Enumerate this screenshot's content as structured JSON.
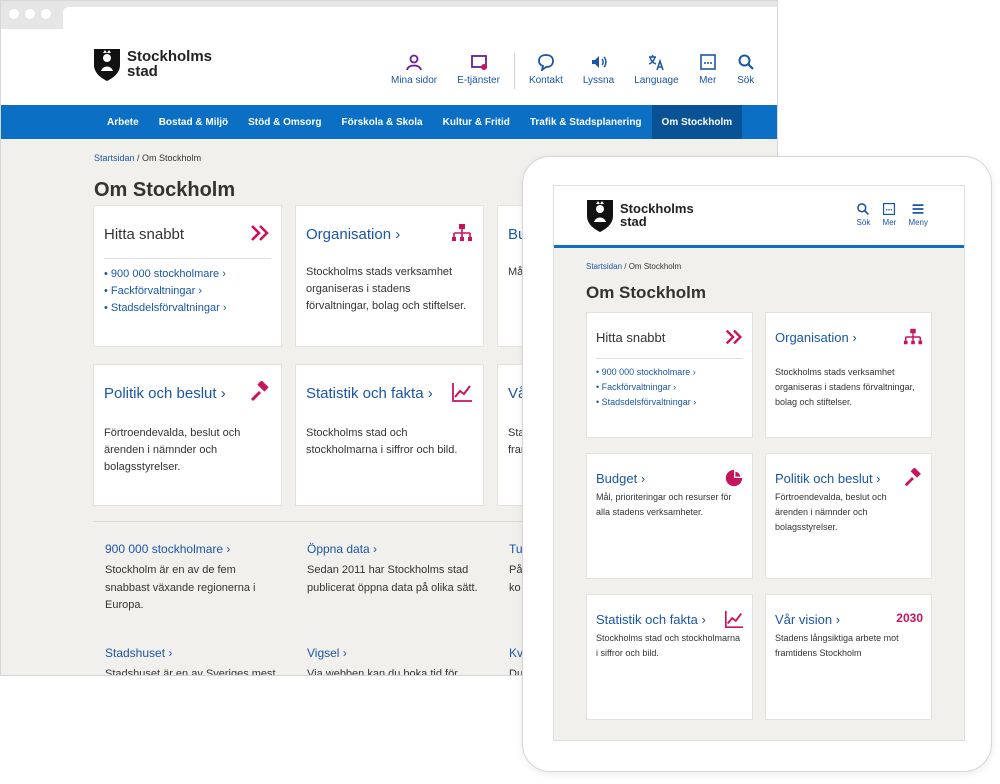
{
  "brand": {
    "line1": "Stockholms",
    "line2": "stad",
    "accent": "#c7145d",
    "primary": "#0b6fc4"
  },
  "desktop": {
    "header_icons": [
      {
        "icon": "person-icon",
        "label": "Mina sidor"
      },
      {
        "icon": "e-services-icon",
        "label": "E-tjänster"
      },
      {
        "icon": "chat-icon",
        "label": "Kontakt"
      },
      {
        "icon": "speaker-icon",
        "label": "Lyssna"
      },
      {
        "icon": "translate-icon",
        "label": "Language"
      },
      {
        "icon": "more-icon",
        "label": "Mer"
      },
      {
        "icon": "search-icon",
        "label": "Sök"
      }
    ],
    "nav": [
      "Arbete",
      "Bostad & Miljö",
      "Stöd & Omsorg",
      "Förskola & Skola",
      "Kultur & Fritid",
      "Trafik & Stadsplanering",
      "Om Stockholm"
    ],
    "breadcrumb": {
      "home": "Startsidan",
      "sep": " / ",
      "current": "Om Stockholm"
    },
    "title": "Om Stockholm",
    "cards": {
      "hitta": {
        "title": "Hitta snabbt",
        "links": [
          "900 000 stockholmare ›",
          "Fackförvaltningar ›",
          "Stadsdelsförvaltningar ›"
        ]
      },
      "org": {
        "title": "Organisation ›",
        "text": "Stockholms stads verksamhet organiseras i stadens förvaltningar, bolag och stiftelser."
      },
      "bu": {
        "title": "Bu",
        "text": "Mål"
      },
      "politik": {
        "title": "Politik och beslut ›",
        "text": "Förtroendevalda, beslut och ärenden i nämnder och bolagsstyrelser."
      },
      "statistik": {
        "title": "Statistik och fakta ›",
        "text": "Stockholms stad och stockholmarna i siffror och bild."
      },
      "var": {
        "title": "Vår",
        "text1": "Sta",
        "text2": "fram"
      }
    },
    "lower": {
      "a_title": "900 000 stockholmare ›",
      "a_text": "Stockholm är en av de fem snabbast växande regionerna i Europa.",
      "b_title": "Öppna data ›",
      "b_text": "Sedan 2011 har Stockholms stad publicerat öppna data på olika sätt.",
      "c_title": "Tu",
      "c_text1": "På",
      "c_text2": "ko",
      "d_title": "Stadshuset ›",
      "d_text": "Stadshuset är en av Sveriges mest",
      "e_title": "Vigsel ›",
      "e_text": "Via webben kan du boka tid för",
      "f_title": "Kva",
      "f_text": "Du"
    }
  },
  "tablet": {
    "header_icons": [
      {
        "icon": "search-icon",
        "label": "Sök"
      },
      {
        "icon": "more-icon",
        "label": "Mer"
      },
      {
        "icon": "menu-icon",
        "label": "Meny"
      }
    ],
    "breadcrumb": {
      "home": "Startsidan",
      "sep": " / ",
      "current": "Om Stockholm"
    },
    "title": "Om Stockholm",
    "cards": {
      "hitta": {
        "title": "Hitta snabbt",
        "links": [
          "900 000 stockholmare ›",
          "Fackförvaltningar ›",
          "Stadsdelsförvaltningar ›"
        ]
      },
      "org": {
        "title": "Organisation ›",
        "text": "Stockholms stads verksamhet organiseras i stadens förvaltningar, bolag och stiftelser."
      },
      "budget": {
        "title": "Budget ›",
        "text": "Mål, prioriteringar och resurser för alla stadens verksamheter."
      },
      "politik": {
        "title": "Politik och beslut ›",
        "text": "Förtroendevalda, beslut och ärenden i nämnder och bolagsstyrelser."
      },
      "statistik": {
        "title": "Statistik och fakta ›",
        "text": "Stockholms stad och stockholmarna i siffror och bild."
      },
      "vision": {
        "title": "Vår vision ›",
        "badge": "2030",
        "text": "Stadens långsiktiga arbete mot framtidens Stockholm"
      }
    }
  }
}
